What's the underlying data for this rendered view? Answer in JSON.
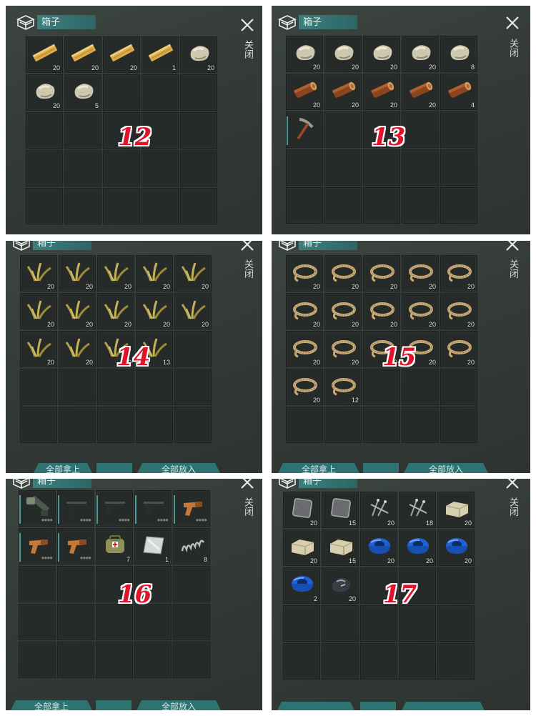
{
  "colors": {
    "panel_bg": "#363d39",
    "slot_bg": "#262b29",
    "title_tab": "#357372",
    "accent_teal": "#2f7272",
    "number_red": "#e0132b"
  },
  "title": "箱子",
  "close_label": "关闭",
  "bottom_bar": {
    "take_all_label": "全部拿上",
    "put_all_label": "全部放入"
  },
  "panels": [
    {
      "number": "12",
      "slots": [
        {
          "icon": "wood-plank-icon",
          "count": "20"
        },
        {
          "icon": "wood-plank-icon",
          "count": "20"
        },
        {
          "icon": "wood-plank-icon",
          "count": "20"
        },
        {
          "icon": "wood-plank-icon",
          "count": "1"
        },
        {
          "icon": "stone-icon",
          "count": "20"
        },
        {
          "icon": "stone-icon",
          "count": "20"
        },
        {
          "icon": "stone-icon",
          "count": "5"
        }
      ]
    },
    {
      "number": "13",
      "slots": [
        {
          "icon": "stone-icon",
          "count": "20"
        },
        {
          "icon": "stone-icon",
          "count": "20"
        },
        {
          "icon": "stone-icon",
          "count": "20"
        },
        {
          "icon": "stone-icon",
          "count": "20"
        },
        {
          "icon": "stone-icon",
          "count": "8"
        },
        {
          "icon": "log-icon",
          "count": "20"
        },
        {
          "icon": "log-icon",
          "count": "20"
        },
        {
          "icon": "log-icon",
          "count": "20"
        },
        {
          "icon": "log-icon",
          "count": "20"
        },
        {
          "icon": "log-icon",
          "count": "4"
        },
        {
          "icon": "pickaxe-icon",
          "count": ""
        }
      ]
    },
    {
      "number": "14",
      "slots": [
        {
          "icon": "plant-fiber-icon",
          "count": "20"
        },
        {
          "icon": "plant-fiber-icon",
          "count": "20"
        },
        {
          "icon": "plant-fiber-icon",
          "count": "20"
        },
        {
          "icon": "plant-fiber-icon",
          "count": "20"
        },
        {
          "icon": "plant-fiber-icon",
          "count": "20"
        },
        {
          "icon": "plant-fiber-icon",
          "count": "20"
        },
        {
          "icon": "plant-fiber-icon",
          "count": "20"
        },
        {
          "icon": "plant-fiber-icon",
          "count": "20"
        },
        {
          "icon": "plant-fiber-icon",
          "count": "20"
        },
        {
          "icon": "plant-fiber-icon",
          "count": "20"
        },
        {
          "icon": "plant-fiber-icon",
          "count": "20"
        },
        {
          "icon": "plant-fiber-icon",
          "count": "20"
        },
        {
          "icon": "plant-fiber-icon",
          "count": "20"
        },
        {
          "icon": "plant-fiber-icon",
          "count": "13"
        }
      ]
    },
    {
      "number": "15",
      "slots": [
        {
          "icon": "rope-icon",
          "count": "20"
        },
        {
          "icon": "rope-icon",
          "count": "20"
        },
        {
          "icon": "rope-icon",
          "count": "20"
        },
        {
          "icon": "rope-icon",
          "count": "20"
        },
        {
          "icon": "rope-icon",
          "count": "20"
        },
        {
          "icon": "rope-icon",
          "count": "20"
        },
        {
          "icon": "rope-icon",
          "count": "20"
        },
        {
          "icon": "rope-icon",
          "count": "20"
        },
        {
          "icon": "rope-icon",
          "count": "20"
        },
        {
          "icon": "rope-icon",
          "count": "20"
        },
        {
          "icon": "rope-icon",
          "count": "20"
        },
        {
          "icon": "rope-icon",
          "count": "20"
        },
        {
          "icon": "rope-icon",
          "count": "20"
        },
        {
          "icon": "rope-icon",
          "count": "20"
        },
        {
          "icon": "rope-icon",
          "count": "20"
        },
        {
          "icon": "rope-icon",
          "count": "20"
        },
        {
          "icon": "rope-icon",
          "count": "12"
        }
      ]
    },
    {
      "number": "16",
      "slots": [
        {
          "icon": "crossbow-icon",
          "count": ""
        },
        {
          "icon": "pistol-icon",
          "count": ""
        },
        {
          "icon": "pistol-icon",
          "count": ""
        },
        {
          "icon": "pistol-icon",
          "count": ""
        },
        {
          "icon": "flare-gun-icon",
          "count": ""
        },
        {
          "icon": "flare-gun-icon",
          "count": ""
        },
        {
          "icon": "flare-gun-icon",
          "count": ""
        },
        {
          "icon": "first-aid-bag-icon",
          "count": "7"
        },
        {
          "icon": "metal-sheet-icon",
          "count": "1"
        },
        {
          "icon": "spring-icon",
          "count": "8"
        }
      ]
    },
    {
      "number": "17",
      "slots": [
        {
          "icon": "iron-plate-icon",
          "count": "20"
        },
        {
          "icon": "iron-plate-icon",
          "count": "15"
        },
        {
          "icon": "nails-icon",
          "count": "20"
        },
        {
          "icon": "nails-icon",
          "count": "18"
        },
        {
          "icon": "stone-block-icon",
          "count": "20"
        },
        {
          "icon": "stone-block-icon",
          "count": "20"
        },
        {
          "icon": "stone-block-icon",
          "count": "15"
        },
        {
          "icon": "duct-tape-icon",
          "count": "20"
        },
        {
          "icon": "duct-tape-icon",
          "count": "20"
        },
        {
          "icon": "duct-tape-icon",
          "count": "20"
        },
        {
          "icon": "duct-tape-icon",
          "count": "2"
        },
        {
          "icon": "coal-icon",
          "count": "20"
        }
      ]
    }
  ]
}
